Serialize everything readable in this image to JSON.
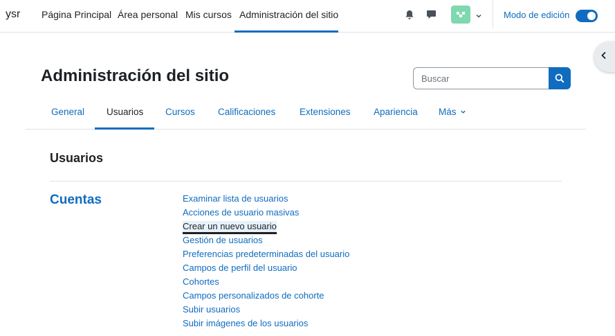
{
  "navbar": {
    "brand": "ysr",
    "items": [
      {
        "label": "Página Principal"
      },
      {
        "label": "Área personal"
      },
      {
        "label": "Mis cursos"
      },
      {
        "label": "Administración del sitio",
        "active": true
      }
    ],
    "icons": {
      "notifications": "bell-icon",
      "messages": "chat-icon",
      "user_menu": "chevron-down-icon"
    },
    "edit_mode_label": "Modo de edición",
    "edit_mode_on": true
  },
  "header": {
    "title": "Administración del sitio",
    "search_placeholder": "Buscar"
  },
  "tabs": [
    {
      "label": "General"
    },
    {
      "label": "Usuarios",
      "active": true
    },
    {
      "label": "Cursos"
    },
    {
      "label": "Calificaciones"
    },
    {
      "label": "Extensiones"
    },
    {
      "label": "Apariencia"
    },
    {
      "label": "Más"
    }
  ],
  "main": {
    "section_title": "Usuarios",
    "category": "Cuentas",
    "links": [
      {
        "label": "Examinar lista de usuarios"
      },
      {
        "label": "Acciones de usuario masivas"
      },
      {
        "label": "Crear un nuevo usuario",
        "focused": true
      },
      {
        "label": "Gestión de usuarios"
      },
      {
        "label": "Preferencias predeterminadas del usuario"
      },
      {
        "label": "Campos de perfil del usuario"
      },
      {
        "label": "Cohortes"
      },
      {
        "label": "Campos personalizados de cohorte"
      },
      {
        "label": "Subir usuarios"
      },
      {
        "label": "Subir imágenes de los usuarios"
      }
    ]
  },
  "colors": {
    "accent": "#0f6cbf",
    "text": "#1d2125",
    "avatar": "#7fd8b0"
  }
}
